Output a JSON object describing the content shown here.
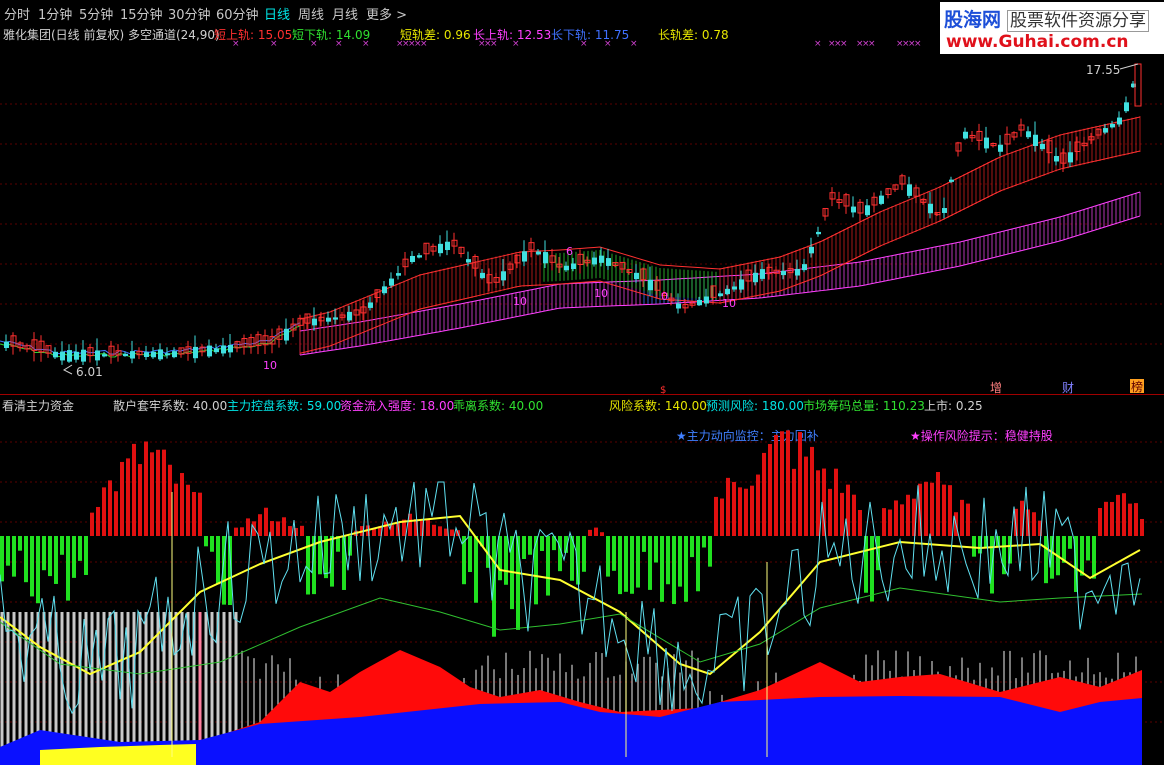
{
  "toolbar": {
    "items": [
      "分时",
      "1分钟",
      "5分钟",
      "15分钟",
      "30分钟",
      "60分钟",
      "日线",
      "周线",
      "月线",
      "更多 >"
    ],
    "active": "日线"
  },
  "logo": {
    "brand": "股海网",
    "slogan": "股票软件资源分享",
    "url": "www.Guhai.com.cn"
  },
  "main_chart": {
    "title": "雅化集团(日线 前复权) 多空通道(24,90)",
    "indicators": [
      {
        "label": "短上轨:",
        "value": "15.05",
        "color": "#ff3030"
      },
      {
        "label": "短下轨:",
        "value": "14.09",
        "color": "#30e030"
      },
      {
        "label": "短轨差:",
        "value": "0.96",
        "color": "#e6e600"
      },
      {
        "label": "长上轨:",
        "value": "12.53",
        "color": "#ff40ff"
      },
      {
        "label": "长下轨:",
        "value": "11.75",
        "color": "#4070ff"
      },
      {
        "label": "长轨差:",
        "value": "0.78",
        "color": "#e6e600"
      }
    ],
    "high_label": "17.55",
    "low_label": "6.01",
    "markers": [
      "6",
      "10",
      "10",
      "0",
      "10",
      "10"
    ],
    "corner_icons": [
      "增",
      "财",
      "榜"
    ]
  },
  "sub_chart": {
    "title": "看清主力资金",
    "indicators": [
      {
        "label": "散户套牢系数:",
        "value": "40.00",
        "color": "#d0d0d0"
      },
      {
        "label": "主力控盘系数:",
        "value": "59.00",
        "color": "#00e5e5"
      },
      {
        "label": "资金流入强度:",
        "value": "18.00",
        "color": "#ff40ff"
      },
      {
        "label": "乖离系数:",
        "value": "40.00",
        "color": "#30e030"
      },
      {
        "label": "风险系数:",
        "value": "140.00",
        "color": "#e6e600"
      },
      {
        "label": "预测风险:",
        "value": "180.00",
        "color": "#00e5e5"
      },
      {
        "label": "市场筹码总量:",
        "value": "110.23",
        "color": "#30e030"
      },
      {
        "label": "上市:",
        "value": "0.25",
        "color": "#d0d0d0"
      }
    ],
    "notes": [
      {
        "text": "★主力动向监控：主力回补",
        "color": "#4080ff"
      },
      {
        "text": "★操作风险提示：稳健持股",
        "color": "#ff40ff"
      }
    ]
  }
}
